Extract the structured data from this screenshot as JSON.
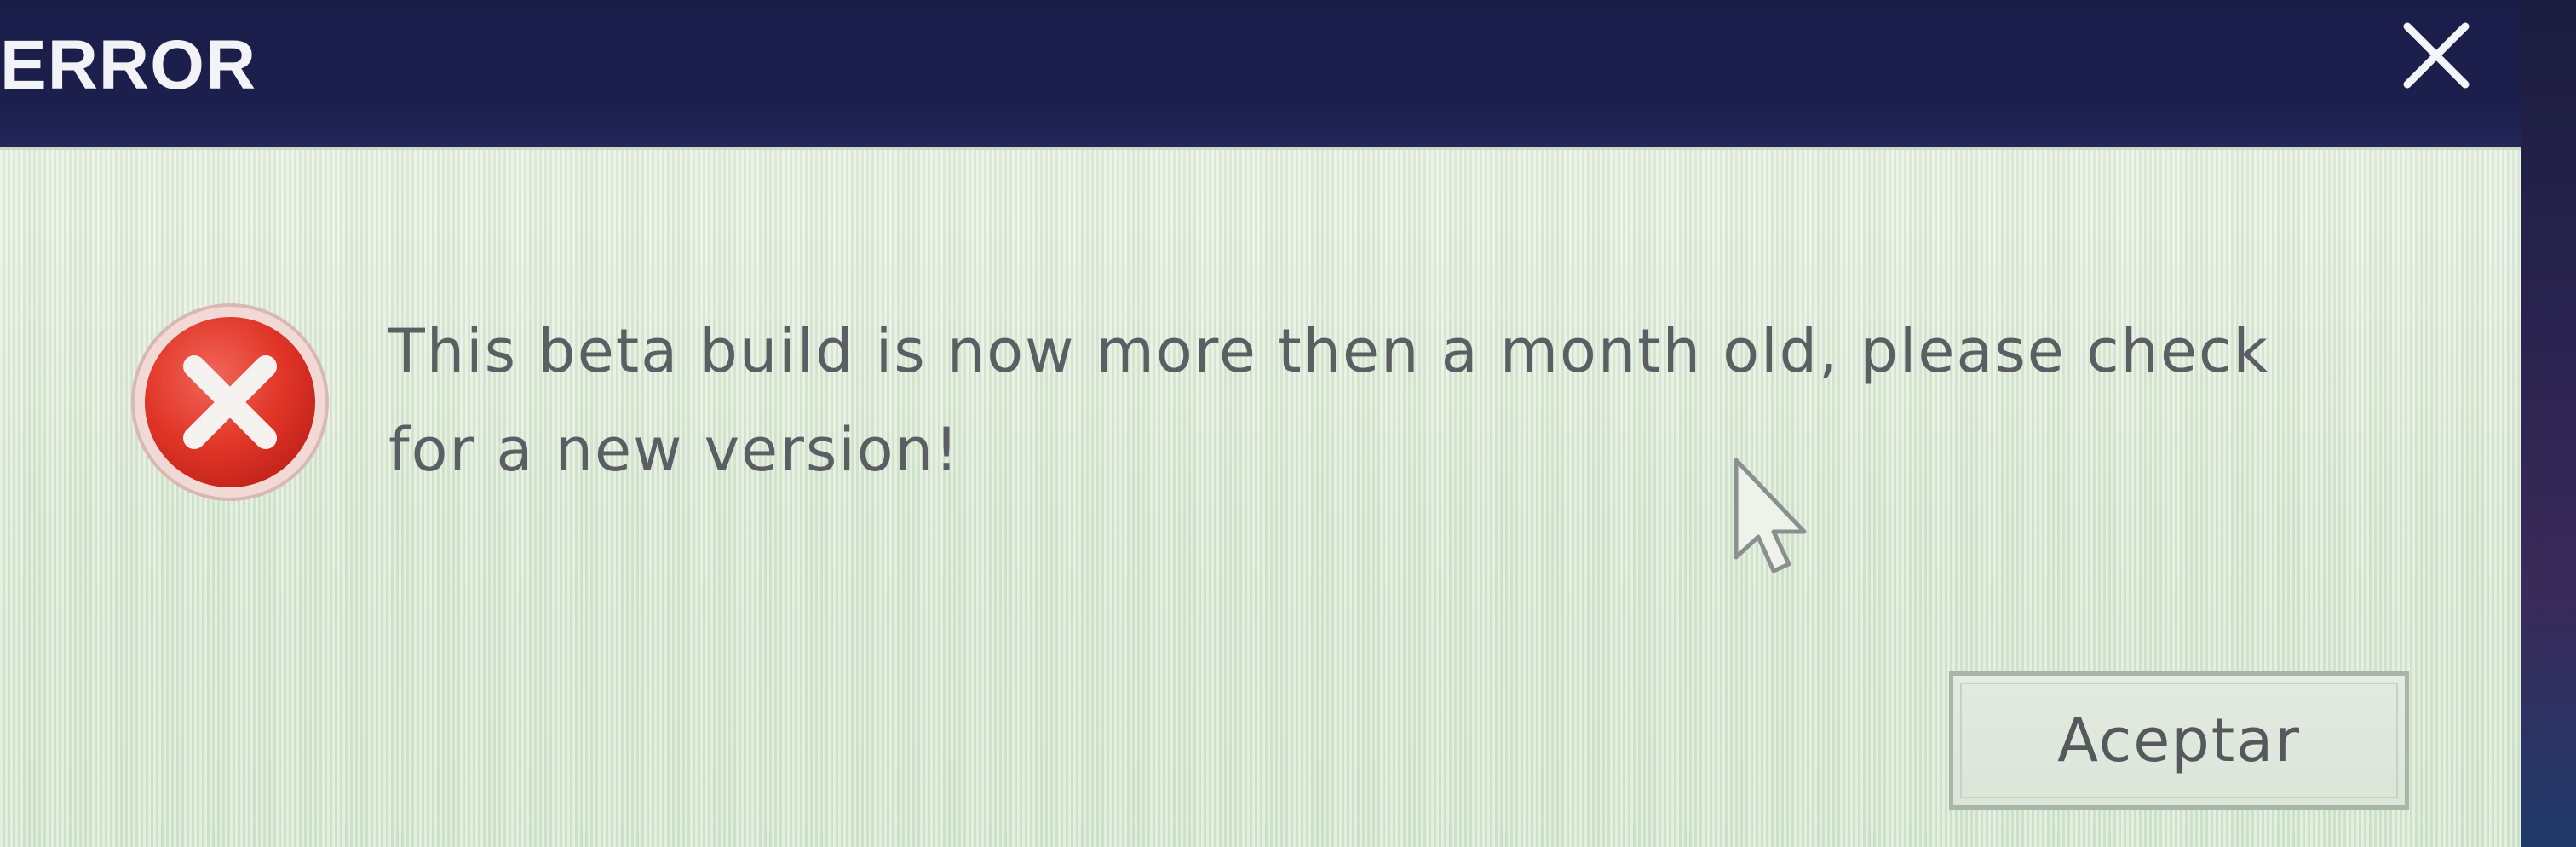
{
  "window": {
    "title": "ERROR",
    "close_icon": "close-icon"
  },
  "dialog": {
    "icon": "error-icon",
    "message": "This beta build is now more then a month old, please check\nfor a new version!",
    "ok_label": "Aceptar"
  },
  "colors": {
    "titlebar": "#1c1f4c",
    "body": "#dbe9d4",
    "error_red": "#e23a2c",
    "text": "#5b5f63"
  }
}
